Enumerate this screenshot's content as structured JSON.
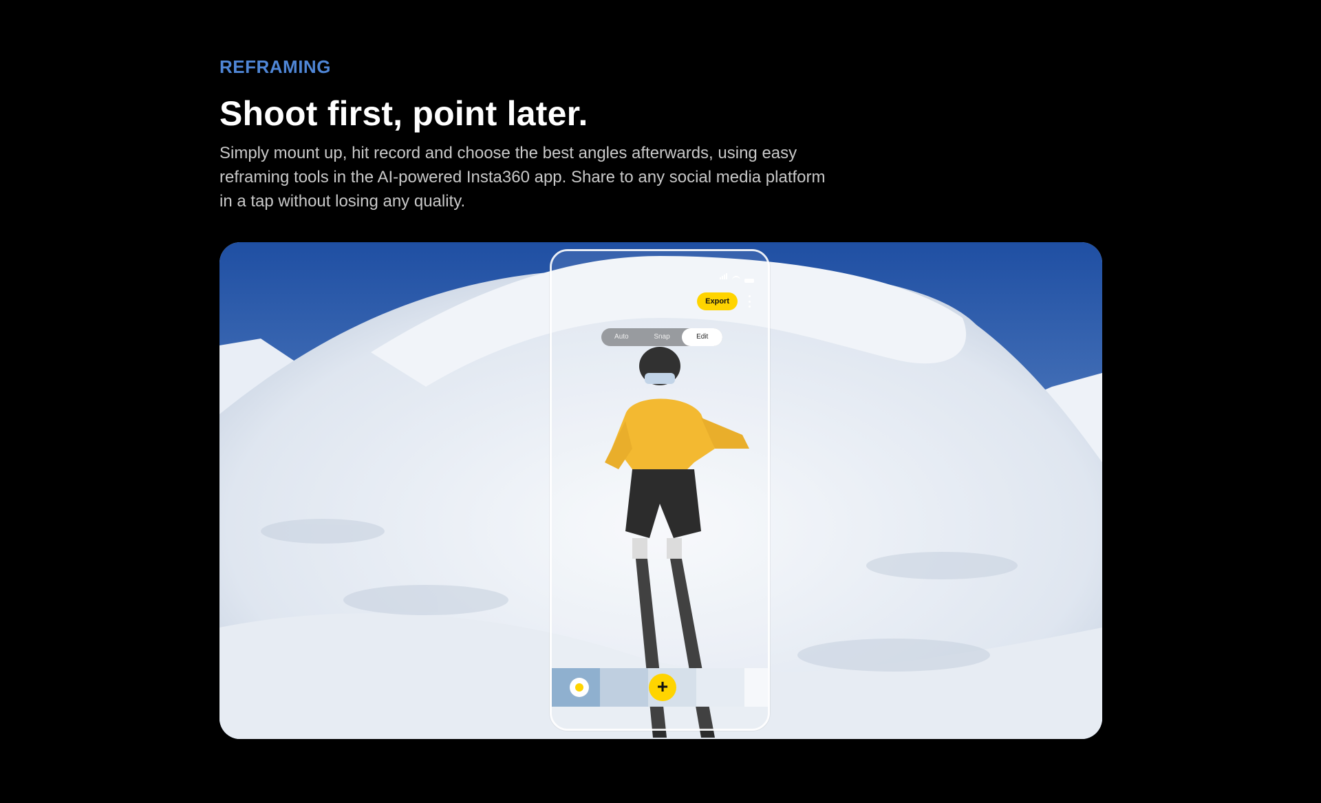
{
  "section": {
    "eyebrow": "REFRAMING",
    "headline": "Shoot first, point later.",
    "body_line1": "Simply mount up, hit record and choose the best angles afterwards, using easy",
    "body_line2": "reframing tools in the AI-powered Insta360 app. Share to any social media platform",
    "body_line3": "in a tap without losing any quality."
  },
  "phone_ui": {
    "export_label": "Export",
    "modes": [
      "Auto",
      "Snap",
      "Edit"
    ],
    "active_mode": "Edit",
    "add_label": "+"
  },
  "colors": {
    "accent_eyebrow": "#4f86d6",
    "accent_yellow": "#ffd400",
    "background": "#000000"
  }
}
